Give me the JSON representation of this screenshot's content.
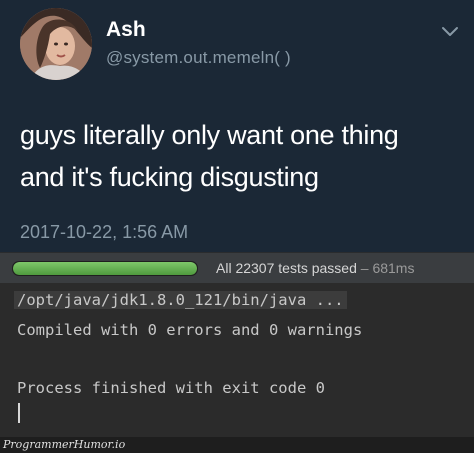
{
  "tweet": {
    "author_name": "Ash",
    "author_handle": "@system.out.memeln( )",
    "text_line_1": "guys literally only want one thing",
    "text_line_2": "and it's fucking disgusting",
    "timestamp": "2017-10-22, 1:56 AM",
    "icons": {
      "avatar": "profile-photo",
      "menu": "chevron-down-icon"
    }
  },
  "test_runner": {
    "progress": 1.0,
    "status": "All 22307 tests passed",
    "separator": " – ",
    "duration": "681ms",
    "colors": {
      "progress": "#5fae4c"
    }
  },
  "console": {
    "command": "/opt/java/jdk1.8.0_121/bin/java ...",
    "compile_result": "Compiled with 0 errors and 0 warnings",
    "exit_message": "Process finished with exit code 0"
  },
  "footer": {
    "watermark": "ProgrammerHumor.io"
  },
  "colors": {
    "tweet_background": "#1b2836",
    "console_background": "#2b2b2b"
  }
}
